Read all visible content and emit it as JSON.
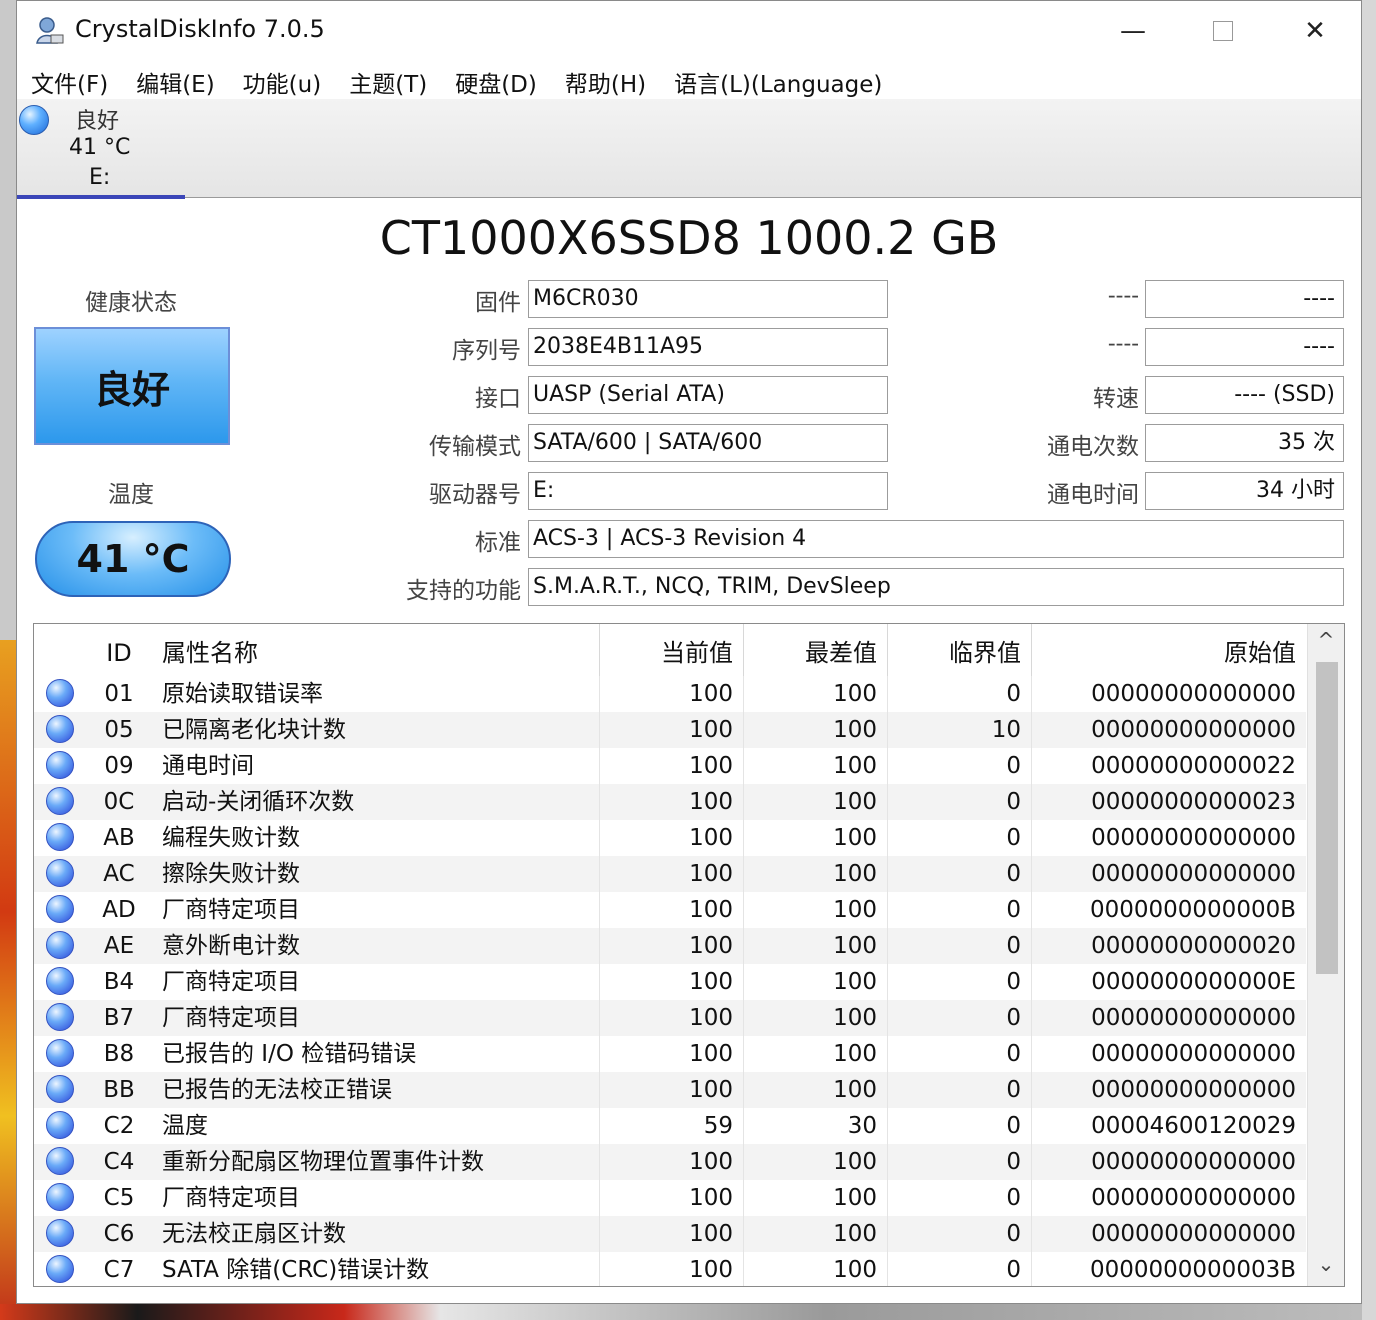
{
  "window": {
    "title": "CrystalDiskInfo 7.0.5",
    "minimize": "—",
    "maximize": "☐",
    "close": "✕"
  },
  "menu": [
    "文件(F)",
    "编辑(E)",
    "功能(u)",
    "主题(T)",
    "硬盘(D)",
    "帮助(H)",
    "语言(L)(Language)"
  ],
  "disk_tab": {
    "status": "良好",
    "temperature": "41 °C",
    "letter": "E:",
    "icon": "status-good-dot"
  },
  "model_title": "CT1000X6SSD8 1000.2 GB",
  "health": {
    "label": "健康状态",
    "value": "良好",
    "color": "#4aa8f0"
  },
  "temperature": {
    "label": "温度",
    "value": "41 °C"
  },
  "fields": {
    "firmware": {
      "label": "固件",
      "value": "M6CR030"
    },
    "serial": {
      "label": "序列号",
      "value": "2038E4B11A95"
    },
    "interface": {
      "label": "接口",
      "value": "UASP (Serial ATA)"
    },
    "transfer_mode": {
      "label": "传输模式",
      "value": "SATA/600 | SATA/600"
    },
    "drive_letter": {
      "label": "驱动器号",
      "value": "E:"
    },
    "standard": {
      "label": "标准",
      "value": "ACS-3 | ACS-3 Revision 4"
    },
    "features": {
      "label": "支持的功能",
      "value": "S.M.A.R.T., NCQ, TRIM, DevSleep"
    },
    "r1": {
      "label": "----",
      "value": "----"
    },
    "r2": {
      "label": "----",
      "value": "----"
    },
    "rotation": {
      "label": "转速",
      "value": "---- (SSD)"
    },
    "power_count": {
      "label": "通电次数",
      "value": "35 次"
    },
    "power_hours": {
      "label": "通电时间",
      "value": "34 小时"
    }
  },
  "table": {
    "headers": {
      "id": "ID",
      "name": "属性名称",
      "current": "当前值",
      "worst": "最差值",
      "threshold": "临界值",
      "raw": "原始值"
    },
    "rows": [
      {
        "id": "01",
        "name": "原始读取错误率",
        "current": "100",
        "worst": "100",
        "threshold": "0",
        "raw": "00000000000000"
      },
      {
        "id": "05",
        "name": "已隔离老化块计数",
        "current": "100",
        "worst": "100",
        "threshold": "10",
        "raw": "00000000000000"
      },
      {
        "id": "09",
        "name": "通电时间",
        "current": "100",
        "worst": "100",
        "threshold": "0",
        "raw": "00000000000022"
      },
      {
        "id": "0C",
        "name": "启动-关闭循环次数",
        "current": "100",
        "worst": "100",
        "threshold": "0",
        "raw": "00000000000023"
      },
      {
        "id": "AB",
        "name": "编程失败计数",
        "current": "100",
        "worst": "100",
        "threshold": "0",
        "raw": "00000000000000"
      },
      {
        "id": "AC",
        "name": "擦除失败计数",
        "current": "100",
        "worst": "100",
        "threshold": "0",
        "raw": "00000000000000"
      },
      {
        "id": "AD",
        "name": "厂商特定项目",
        "current": "100",
        "worst": "100",
        "threshold": "0",
        "raw": "0000000000000B"
      },
      {
        "id": "AE",
        "name": "意外断电计数",
        "current": "100",
        "worst": "100",
        "threshold": "0",
        "raw": "00000000000020"
      },
      {
        "id": "B4",
        "name": "厂商特定项目",
        "current": "100",
        "worst": "100",
        "threshold": "0",
        "raw": "0000000000000E"
      },
      {
        "id": "B7",
        "name": "厂商特定项目",
        "current": "100",
        "worst": "100",
        "threshold": "0",
        "raw": "00000000000000"
      },
      {
        "id": "B8",
        "name": "已报告的 I/O 检错码错误",
        "current": "100",
        "worst": "100",
        "threshold": "0",
        "raw": "00000000000000"
      },
      {
        "id": "BB",
        "name": "已报告的无法校正错误",
        "current": "100",
        "worst": "100",
        "threshold": "0",
        "raw": "00000000000000"
      },
      {
        "id": "C2",
        "name": "温度",
        "current": "59",
        "worst": "30",
        "threshold": "0",
        "raw": "00004600120029"
      },
      {
        "id": "C4",
        "name": "重新分配扇区物理位置事件计数",
        "current": "100",
        "worst": "100",
        "threshold": "0",
        "raw": "00000000000000"
      },
      {
        "id": "C5",
        "name": "厂商特定项目",
        "current": "100",
        "worst": "100",
        "threshold": "0",
        "raw": "00000000000000"
      },
      {
        "id": "C6",
        "name": "无法校正扇区计数",
        "current": "100",
        "worst": "100",
        "threshold": "0",
        "raw": "00000000000000"
      },
      {
        "id": "C7",
        "name": "SATA 除错(CRC)错误计数",
        "current": "100",
        "worst": "100",
        "threshold": "0",
        "raw": "0000000000003B"
      }
    ]
  },
  "scrollbar": {
    "up": "^",
    "down": "⌄"
  }
}
